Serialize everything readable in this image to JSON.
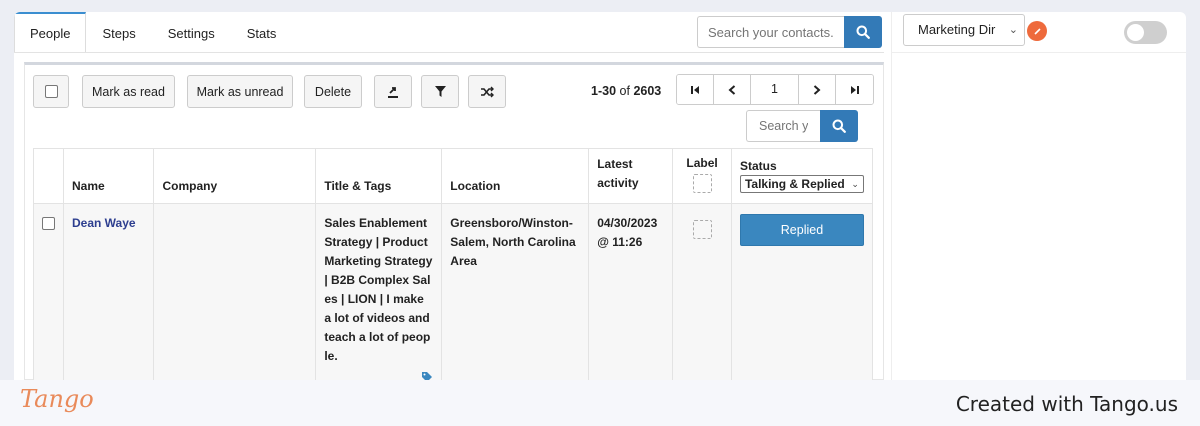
{
  "tabs": [
    {
      "label": "People",
      "active": true
    },
    {
      "label": "Steps"
    },
    {
      "label": "Settings"
    },
    {
      "label": "Stats"
    }
  ],
  "top_search": {
    "placeholder": "Search your contacts..."
  },
  "campaign_dropdown": {
    "value": "Marketing Dir"
  },
  "toggle": {
    "on": false
  },
  "toolbar": {
    "mark_read_label": "Mark as read",
    "mark_unread_label": "Mark as unread",
    "delete_label": "Delete"
  },
  "pagination": {
    "range": "1-30",
    "of_text": "of",
    "total": "2603",
    "current_page": "1"
  },
  "table_search": {
    "placeholder": "Search yo"
  },
  "table": {
    "headers": {
      "name": "Name",
      "company": "Company",
      "title_tags": "Title & Tags",
      "location": "Location",
      "latest_activity": "Latest activity",
      "label": "Label",
      "status": "Status"
    },
    "status_filter": "Talking & Replied",
    "rows": [
      {
        "name": "Dean Waye",
        "company": "",
        "title": "Sales Enablement Strategy | Product Marketing Strategy | B2B Complex Sales | LION | I make a lot of videos and teach a lot of people.",
        "location": "Greensboro/Winston-Salem, North Carolina Area",
        "activity": "04/30/2023 @ 11:26",
        "status_button": "Replied"
      }
    ]
  },
  "footer": {
    "logo_text": "Tango",
    "created_text": "Created with Tango.us"
  },
  "colors": {
    "accent": "#3b8ed0",
    "primary_button": "#337ab7",
    "name_link": "#2d3e8f",
    "orange_badge": "#ee6a3c",
    "logo": "#e98a5a"
  }
}
